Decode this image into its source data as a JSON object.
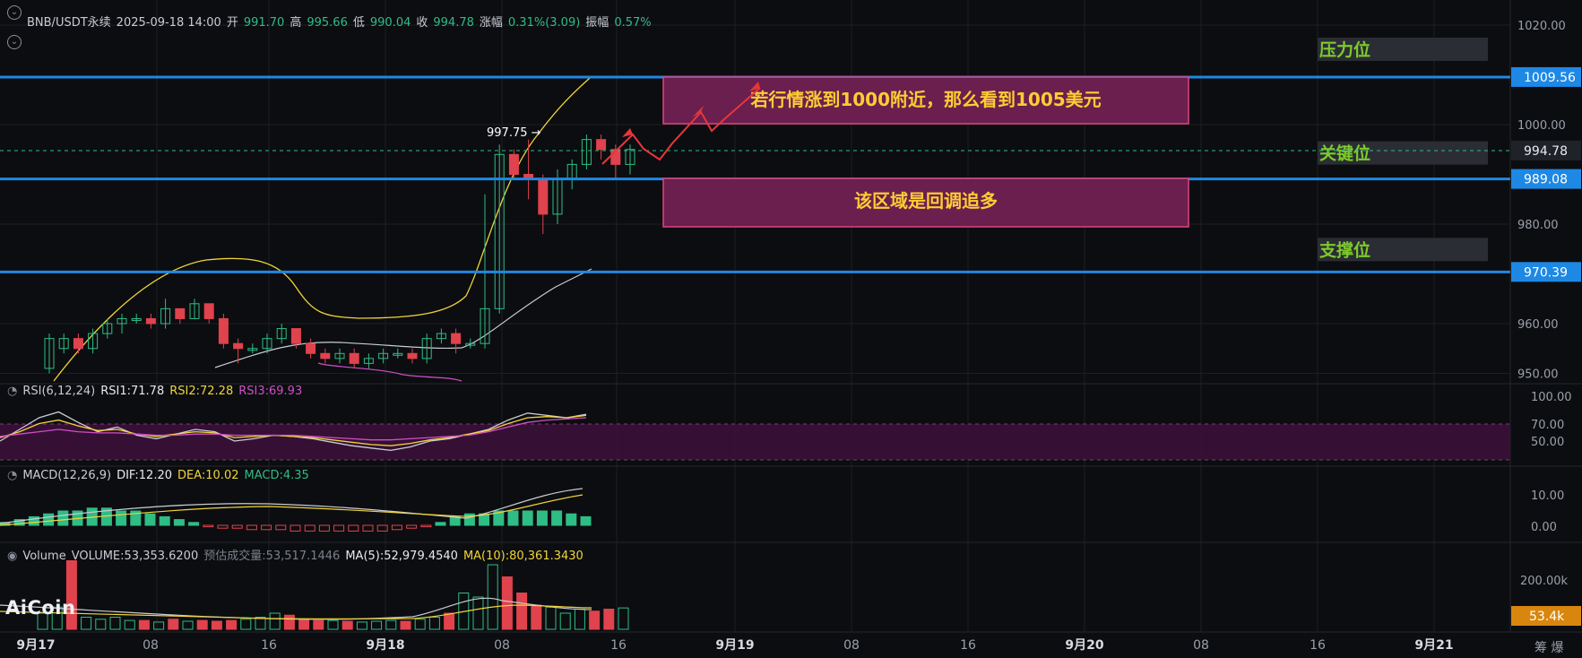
{
  "header": {
    "symbol": "BNB/USDT永续",
    "datetime": "2025-09-18 14:00",
    "open_label": "开",
    "open": "991.70",
    "high_label": "高",
    "high": "995.66",
    "low_label": "低",
    "low": "990.04",
    "close_label": "收",
    "close": "994.78",
    "change_label": "涨幅",
    "change": "0.31%(3.09)",
    "amp_label": "振幅",
    "amp": "0.57%"
  },
  "rsi_header": {
    "name": "RSI(6,12,24)",
    "rsi1": "RSI1:71.78",
    "rsi2": "RSI2:72.28",
    "rsi3": "RSI3:69.93"
  },
  "macd_header": {
    "name": "MACD(12,26,9)",
    "dif": "DIF:12.20",
    "dea": "DEA:10.02",
    "macd": "MACD:4.35"
  },
  "vol_header": {
    "name": "Volume",
    "volume": "VOLUME:53,353.6200",
    "est": "预估成交量:53,517.1446",
    "ma5": "MA(5):52,979.4540",
    "ma10": "MA(10):80,361.3430"
  },
  "logo": "AiCoin",
  "bottom_right": "筹 爆",
  "colors": {
    "up": "#2ebd85",
    "down": "#e0434d",
    "level_line": "#1e88e5",
    "ma_yellow": "#f0d43a",
    "band_white": "#c9ccd2",
    "band_magenta": "#d04ec8",
    "annot_box": "#6a1f4e",
    "annot_border": "#e0457d",
    "annot_text": "#ffcc33",
    "level_text": "#7ecb2c"
  },
  "chart_data": [
    {
      "type": "candlestick",
      "title": "BNB/USDT永续",
      "y_ticks": [
        950,
        960,
        980,
        1000,
        1020
      ],
      "y_tick_labels": [
        "950.00",
        "960.00",
        "980.00",
        "1000.00",
        "1020.00"
      ],
      "x_ticks": [
        "9月17",
        "08",
        "16",
        "9月18",
        "08",
        "16",
        "9月19",
        "08",
        "16",
        "9月20",
        "08",
        "16",
        "9月21"
      ],
      "candles": [
        [
          951,
          957,
          950,
          958
        ],
        [
          955,
          957,
          954,
          958
        ],
        [
          957,
          955,
          954,
          958
        ],
        [
          955,
          958,
          954,
          959
        ],
        [
          958,
          960,
          957,
          961
        ],
        [
          960,
          961,
          958,
          962
        ],
        [
          961,
          961,
          960,
          962
        ],
        [
          961,
          960,
          959,
          962
        ],
        [
          960,
          963,
          959,
          965
        ],
        [
          963,
          961,
          960,
          963
        ],
        [
          961,
          964,
          961,
          965
        ],
        [
          964,
          961,
          960,
          964
        ],
        [
          961,
          956,
          955,
          962
        ],
        [
          956,
          955,
          952,
          957
        ],
        [
          955,
          955,
          954,
          956
        ],
        [
          955,
          957,
          954,
          958
        ],
        [
          957,
          959,
          956,
          960
        ],
        [
          959,
          956,
          955,
          959
        ],
        [
          956,
          954,
          953,
          957
        ],
        [
          954,
          953,
          952,
          955
        ],
        [
          953,
          954,
          952,
          955
        ],
        [
          954,
          952,
          951,
          955
        ],
        [
          952,
          953,
          951,
          954
        ],
        [
          953,
          954,
          952,
          955
        ],
        [
          954,
          954,
          953,
          955
        ],
        [
          954,
          953,
          952,
          955
        ],
        [
          953,
          957,
          952,
          958
        ],
        [
          957,
          958,
          956,
          959
        ],
        [
          958,
          956,
          954,
          959
        ],
        [
          956,
          956,
          955,
          957
        ],
        [
          956,
          963,
          955,
          986
        ],
        [
          963,
          994,
          962,
          996
        ],
        [
          994,
          990,
          989,
          995
        ],
        [
          990,
          989,
          985,
          997
        ],
        [
          989,
          982,
          978,
          990
        ],
        [
          982,
          989,
          980,
          991
        ],
        [
          989,
          992,
          987,
          993
        ],
        [
          992,
          997,
          991,
          998
        ],
        [
          997,
          995,
          993,
          998
        ],
        [
          995,
          992,
          989,
          996
        ],
        [
          992,
          995,
          990,
          996
        ]
      ],
      "levels": [
        {
          "label": "压力位",
          "value": "1009.56"
        },
        {
          "label": "关键位",
          "value": "989.08"
        },
        {
          "label": "支撑位",
          "value": "970.39"
        }
      ],
      "current_price": "994.78",
      "max_label": "997.75",
      "annotations": [
        "若行情涨到1000附近，那么看到1005美元",
        "该区域是回调追多"
      ]
    },
    {
      "type": "line",
      "title": "RSI(6,12,24)",
      "y_tick_labels": [
        "100.00",
        "70.00",
        "50.00"
      ],
      "series": [
        {
          "name": "RSI1",
          "values": [
            50,
            60,
            70,
            75,
            66,
            58,
            62,
            55,
            52,
            56,
            60,
            58,
            50,
            52,
            55,
            54,
            52,
            49,
            46,
            44,
            42,
            45,
            50,
            52,
            56,
            60,
            68,
            74,
            72,
            70,
            73
          ]
        },
        {
          "name": "RSI2",
          "values": [
            53,
            58,
            65,
            68,
            63,
            59,
            60,
            56,
            54,
            56,
            58,
            57,
            53,
            54,
            55,
            54,
            53,
            51,
            49,
            47,
            46,
            48,
            51,
            53,
            56,
            59,
            65,
            70,
            71,
            70,
            72
          ]
        },
        {
          "name": "RSI3",
          "values": [
            54,
            56,
            58,
            60,
            58,
            57,
            57,
            56,
            55,
            55,
            56,
            56,
            55,
            55,
            55,
            55,
            54,
            53,
            52,
            51,
            51,
            52,
            53,
            54,
            55,
            58,
            62,
            66,
            68,
            69,
            70
          ]
        }
      ]
    },
    {
      "type": "bar",
      "title": "MACD(12,26,9)",
      "y_tick_labels": [
        "10.00",
        "0.00"
      ],
      "values": [
        1,
        2,
        3,
        4,
        5,
        5,
        6,
        6,
        5,
        5,
        4,
        3,
        2,
        1,
        -0.5,
        -1,
        -1,
        -1.5,
        -1.5,
        -1.5,
        -2,
        -2,
        -2,
        -2,
        -2,
        -2,
        -2,
        -1.5,
        -1,
        -0.5,
        1,
        3,
        4,
        4,
        5,
        5,
        5,
        5,
        5,
        4,
        3
      ]
    },
    {
      "type": "bar",
      "title": "Volume",
      "y_tick_labels": [
        "200.00k"
      ],
      "current_label": "53.4k",
      "values": [
        40,
        55,
        170,
        30,
        25,
        30,
        22,
        22,
        18,
        25,
        20,
        22,
        20,
        22,
        25,
        30,
        40,
        35,
        25,
        22,
        22,
        20,
        18,
        20,
        22,
        20,
        25,
        30,
        40,
        90,
        80,
        160,
        130,
        90,
        60,
        55,
        40,
        50,
        45,
        50,
        53
      ]
    }
  ]
}
